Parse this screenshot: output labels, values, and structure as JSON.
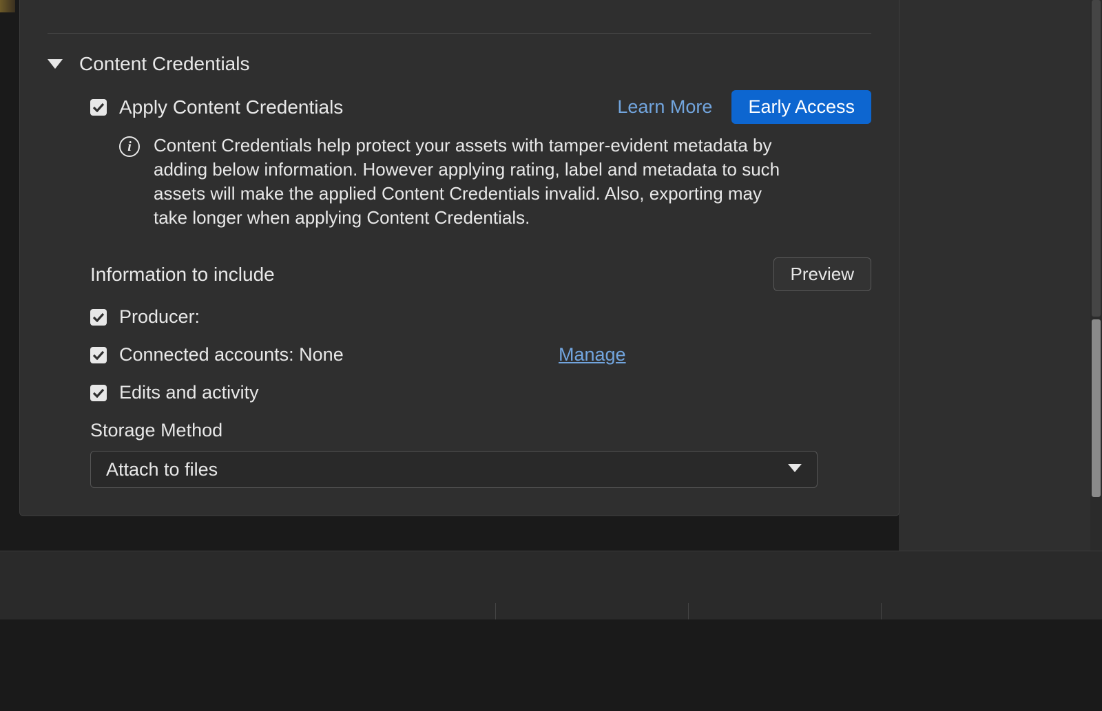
{
  "section": {
    "title": "Content Credentials",
    "apply_label": "Apply Content Credentials",
    "learn_more": "Learn More",
    "early_access": "Early Access",
    "info_text": "Content Credentials help protect your assets with tamper-evident metadata by adding below information. However applying rating, label and metadata to such assets will make the applied Content Credentials invalid. Also, exporting may take longer when applying Content Credentials.",
    "include_title": "Information to include",
    "preview_btn": "Preview",
    "items": {
      "producer": "Producer:",
      "connected": "Connected accounts: None",
      "manage": "Manage",
      "edits": "Edits and activity"
    },
    "storage_label": "Storage Method",
    "storage_value": "Attach to files"
  }
}
